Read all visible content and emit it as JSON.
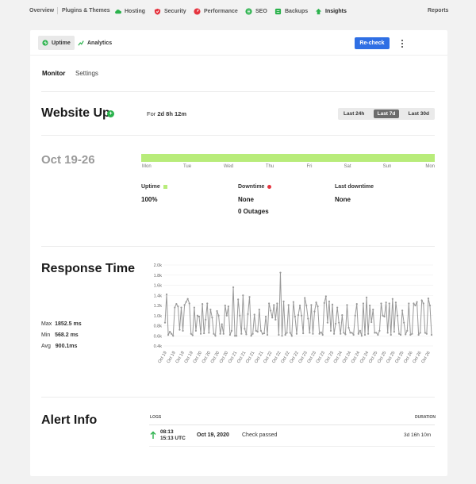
{
  "nav": {
    "items": [
      {
        "label": "Overview",
        "icon": "none"
      },
      {
        "label": "Plugins & Themes",
        "icon": "none"
      },
      {
        "label": "Hosting",
        "icon": "cloud-icon"
      },
      {
        "label": "Security",
        "icon": "shield-icon"
      },
      {
        "label": "Performance",
        "icon": "gauge-icon"
      },
      {
        "label": "SEO",
        "icon": "seo-icon"
      },
      {
        "label": "Backups",
        "icon": "backup-icon"
      },
      {
        "label": "Insights",
        "icon": "insights-icon"
      }
    ],
    "reports": "Reports",
    "accent": "#2bb24c"
  },
  "subtabs": {
    "uptime": "Uptime",
    "analytics": "Analytics"
  },
  "toolbar": {
    "monitor": "Monitor",
    "settings": "Settings",
    "recheck": "Re-check"
  },
  "status": {
    "title": "Website Up",
    "for_prefix": "For",
    "duration": "2d 8h 12m",
    "ranges": [
      "Last 24h",
      "Last 7d",
      "Last 30d"
    ],
    "active_range": "Last 7d"
  },
  "uptime": {
    "date_range": "Oct 19-26",
    "bar_color": "#b8ec7a",
    "days": [
      "Mon",
      "Tue",
      "Wed",
      "Thu",
      "Fri",
      "Sat",
      "Sun",
      "Mon"
    ],
    "uptime_label": "Uptime",
    "uptime_value": "100%",
    "downtime_label": "Downtime",
    "downtime_value": "None",
    "outages": "0 Outages",
    "last_down_label": "Last downtime",
    "last_down_value": "None"
  },
  "response": {
    "title": "Response Time",
    "max_label": "Max",
    "max_value": "1852.5 ms",
    "min_label": "Min",
    "min_value": "568.2 ms",
    "avg_label": "Avg",
    "avg_value": "900.1ms"
  },
  "chart_data": {
    "type": "line",
    "yticks": [
      "2.0k",
      "1.8k",
      "1.6k",
      "1.4k",
      "1.2k",
      "1.0k",
      "0.8k",
      "0.6k",
      "0.4k"
    ],
    "ylim": [
      400,
      2000
    ],
    "x_labels": [
      "Oct 19",
      "Oct 19",
      "Oct 19",
      "Oct 19",
      "Oct 20",
      "Oct 20",
      "Oct 20",
      "Oct 20",
      "Oct 21",
      "Oct 21",
      "Oct 21",
      "Oct 21",
      "Oct 22",
      "Oct 22",
      "Oct 22",
      "Oct 22",
      "Oct 23",
      "Oct 23",
      "Oct 23",
      "Oct 23",
      "Oct 24",
      "Oct 24",
      "Oct 24",
      "Oct 24",
      "Oct 25",
      "Oct 25",
      "Oct 25",
      "Oct 25",
      "Oct 26",
      "Oct 26",
      "Oct 26"
    ],
    "values": [
      860,
      1420,
      620,
      680,
      640,
      600,
      1160,
      1230,
      1180,
      720,
      1160,
      700,
      1210,
      1270,
      1330,
      1240,
      640,
      610,
      1160,
      700,
      1000,
      980,
      640,
      1230,
      650,
      920,
      1240,
      660,
      1120,
      960,
      640,
      600,
      1090,
      1000,
      640,
      830,
      640,
      1200,
      1000,
      1180,
      620,
      700,
      1560,
      600,
      600,
      1320,
      1000,
      640,
      1400,
      740,
      630,
      1030,
      1370,
      600,
      640,
      1020,
      700,
      680,
      1120,
      700,
      640,
      650,
      980,
      620,
      1240,
      1100,
      960,
      1210,
      920,
      1240,
      620,
      1850,
      600,
      1280,
      620,
      660,
      1210,
      660,
      600,
      1270,
      980,
      640,
      1010,
      1200,
      1000,
      650,
      1350,
      1200,
      940,
      660,
      1210,
      640,
      1080,
      1260,
      1180,
      640,
      670,
      620,
      1250,
      1380,
      860,
      1280,
      700,
      1220,
      640,
      840,
      1160,
      860,
      640,
      1010,
      660,
      630,
      1210,
      760,
      660,
      660,
      620,
      1000,
      1230,
      640,
      700,
      600,
      1240,
      620,
      1360,
      640,
      1200,
      870,
      1120,
      660,
      660,
      620,
      700,
      1240,
      1000,
      980,
      1260,
      660,
      1240,
      620,
      1330,
      680,
      1260,
      1000,
      640,
      620,
      1100,
      860,
      630,
      700,
      1240,
      620,
      640,
      1240,
      1200,
      1270,
      620,
      660,
      1300,
      1240,
      660,
      640,
      1340,
      1200,
      620
    ],
    "line_color": "#999999"
  },
  "alerts": {
    "title": "Alert Info",
    "logs_header": "LOGS",
    "duration_header": "DURATION",
    "entries": [
      {
        "time": "08:13",
        "time_utc": "15:13 UTC",
        "date": "Oct 19, 2020",
        "message": "Check passed",
        "duration": "3d 16h 10m"
      }
    ]
  }
}
